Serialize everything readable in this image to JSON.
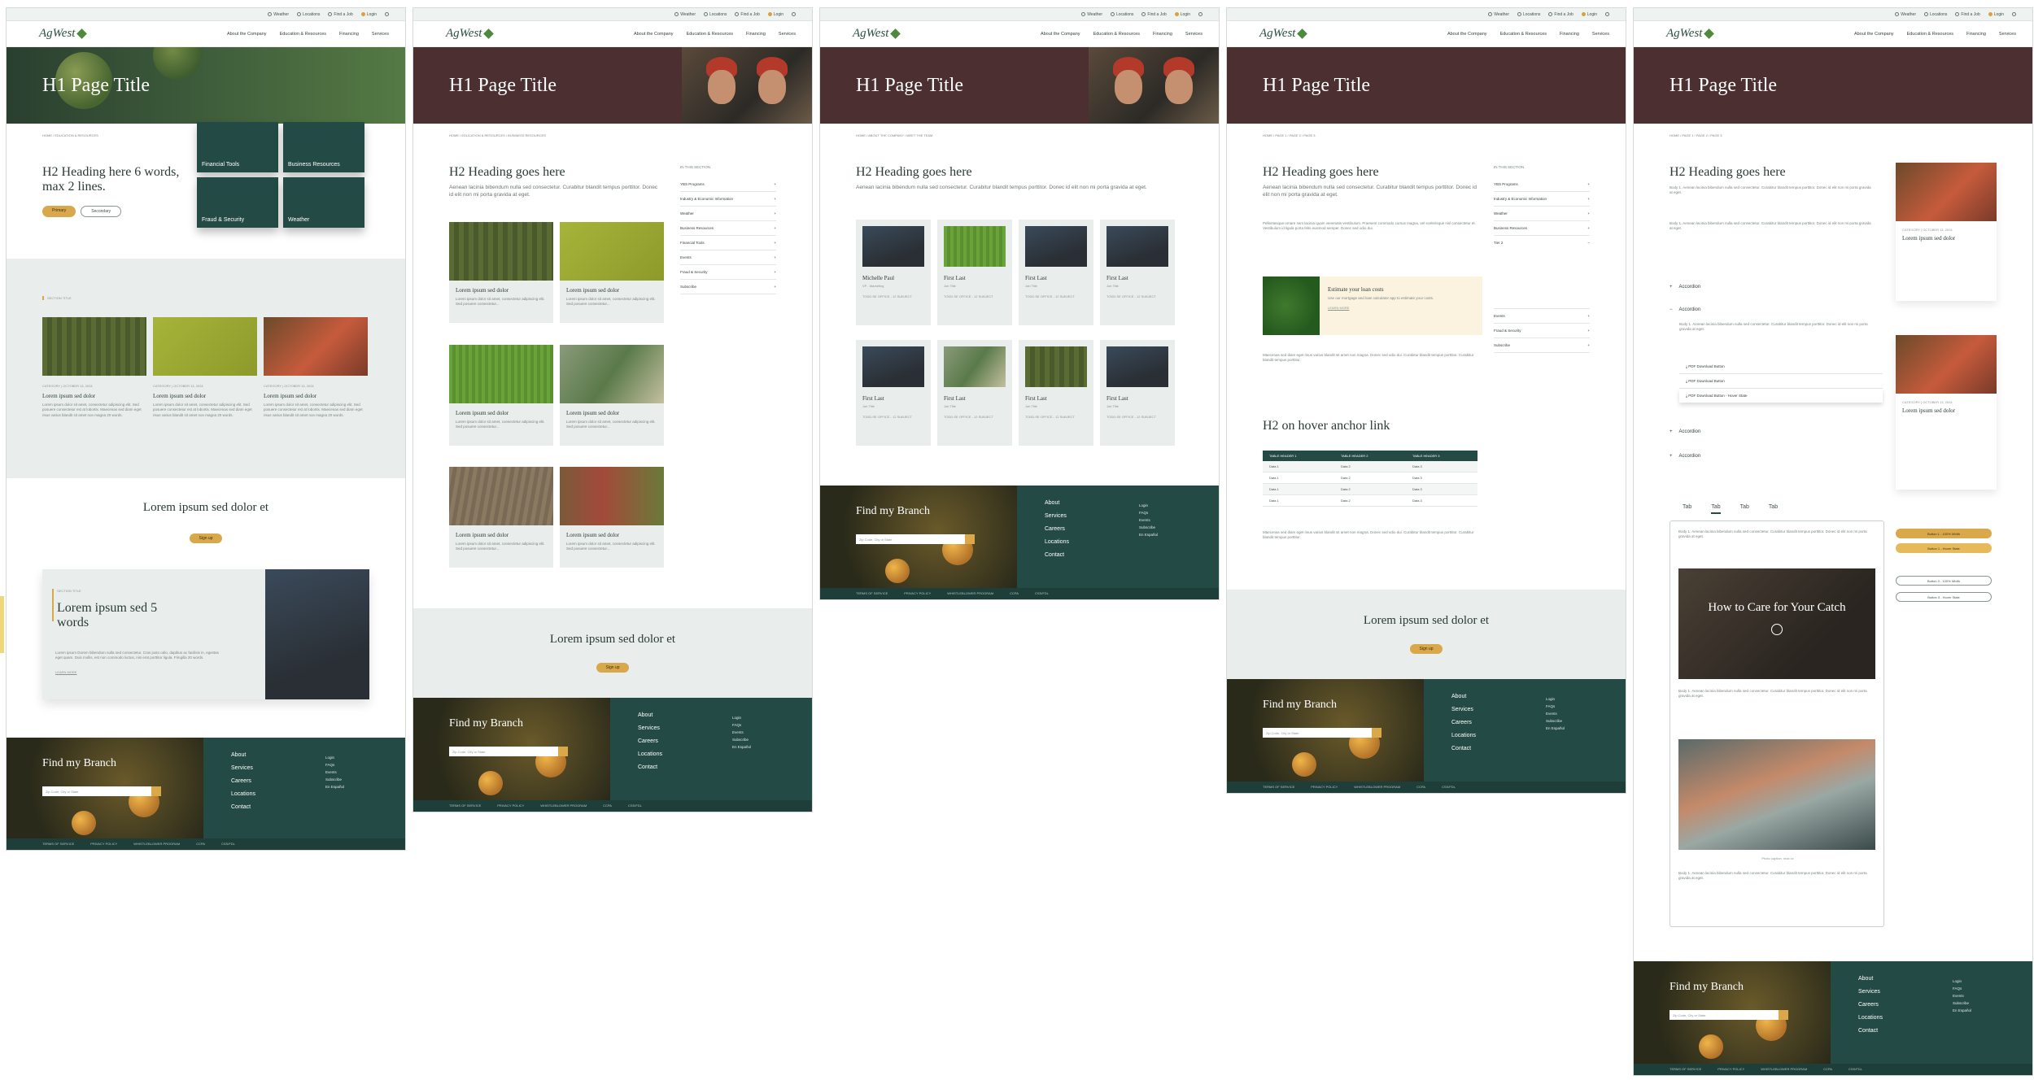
{
  "utility": {
    "weather": "Weather",
    "locations": "Locations",
    "find_job": "Find a Job",
    "login": "Login"
  },
  "nav": {
    "about": "About the Company",
    "education": "Education & Resources",
    "financing": "Financing",
    "services": "Services"
  },
  "logo": {
    "text": "AgWest"
  },
  "hero": {
    "title": "H1 Page Title"
  },
  "p1": {
    "breadcrumb": "HOME  /  EDUCATION & RESOURCES",
    "h2": "H2 Heading here 6 words, max 2 lines.",
    "primary": "Primary",
    "secondary": "Secondary",
    "tiles": [
      "Financial Tools",
      "Business Resources",
      "Fraud & Security",
      "Weather"
    ],
    "section_title": "SECTION TITLE",
    "cards": [
      {
        "meta": "CATEGORY  |  OCTOBER 13, 2024",
        "title": "Lorem ipsum sed dolor",
        "text": "Lorem ipsum dolor sit amet, consectetur adipiscing elit. Sed posuere consectetur est at lobortis. Maecenas sed diam eget risus varius blandit sit amet non magna 20 words."
      },
      {
        "meta": "CATEGORY  |  OCTOBER 13, 2024",
        "title": "Lorem ipsum sed dolor",
        "text": "Lorem ipsum dolor sit amet, consectetur adipiscing elit. Sed posuere consectetur est at lobortis. Maecenas sed diam eget risus varius blandit sit amet non magna 20 words."
      },
      {
        "meta": "CATEGORY  |  OCTOBER 13, 2024",
        "title": "Lorem ipsum sed dolor",
        "text": "Lorem ipsum dolor sit amet, consectetur adipiscing elit. Sed posuere consectetur est at lobortis. Maecenas sed diam eget risus varius blandit sit amet non magna 20 words."
      }
    ],
    "cta_title": "Lorem ipsum sed dolor et",
    "cta_btn": "Sign up",
    "feature_label": "SECTION TITLE",
    "feature_title": "Lorem ipsum sed 5 words",
    "feature_text": "Lorem ipsum Dorem bibendum nulla sed consectetur. Cras justo odio, dapibus ac facilisis in, egestas eget quam. Duis mollis, est non commodo luctus, nisi erat porttitor ligula. Fringilla 20 words.",
    "feature_link": "LEARN MORE"
  },
  "p2": {
    "breadcrumb": "HOME  /  EDUCATION & RESOURCES  /  BUSINESS RESOURCES",
    "h2": "H2 Heading goes here",
    "intro": "Aenean lacinia bibendum nulla sed consectetur. Curabitur blandit tempus porttitor. Donec id elit non mi porta gravida at eget.",
    "in_section": "IN THIS SECTION",
    "side": [
      "YBS Programs",
      "Industry & Economic Information",
      "Weather",
      "Business Resources",
      "Financial Tools",
      "Events",
      "Fraud & Security",
      "Subscribe"
    ],
    "card_title": "Lorem ipsum sed dolor",
    "card_text": "Lorem ipsum dolor sit amet, consectetur adipiscing elit. Sed posuere consectetur...",
    "cta_title": "Lorem ipsum sed dolor et",
    "cta_btn": "Sign up"
  },
  "p3": {
    "breadcrumb": "HOME  /  ABOUT THE COMPANY  /  MEET THE TEAM",
    "h2": "H2 Heading goes here",
    "intro": "Aenean lacinia bibendum nulla sed consectetur. Curabitur blandit tempus porttitor. Donec id elit non mi porta gravida at eget.",
    "people": [
      {
        "name": "Michelle Paul",
        "title": "VP - Marketing"
      },
      {
        "name": "First Last",
        "title": "Job Title"
      },
      {
        "name": "First Last",
        "title": "Job Title"
      },
      {
        "name": "First Last",
        "title": "Job Title"
      },
      {
        "name": "First Last",
        "title": "Job Title"
      },
      {
        "name": "First Last",
        "title": "Job Title"
      },
      {
        "name": "First Last",
        "title": "Job Title"
      },
      {
        "name": "First Last",
        "title": "Job Title"
      }
    ],
    "contact": "TODD.SE OFFICE - 12 SUBJECT"
  },
  "p4": {
    "breadcrumb": "HOME  /  PAGE 1  /  PAGE 2  /  PAGE 3",
    "h2": "H2 Heading goes here",
    "intro": "Aenean lacinia bibendum nulla sed consectetur. Curabitur blandit tempus porttitor. Donec id elit non mi porta gravida at eget.",
    "body1": "Pellentesque ornare sem lacinia quam venenatis vestibulum. Praesent commodo cursus magna, vel scelerisque nisl consectetur et. Vestibulum id ligula porta felis euismod semper. Donec sed odio dui.",
    "estimate_title": "Estimate your loan costs",
    "estimate_text": "Use our mortgage and loan calculator app to estimate your costs.",
    "estimate_link": "LEARN MORE",
    "body2": "Maecenas sed diam eget risus varius blandit sit amet non magna. Donec sed odio dui. Curabitur blandit tempus porttitor. Curabitur blandit tempus porttitor.",
    "h2_anchor": "H2 on hover anchor link",
    "table_headers": [
      "TABLE HEADER 1",
      "TABLE HEADER 2",
      "TABLE HEADER 3"
    ],
    "table_rows": [
      [
        "Data 1",
        "Data 2",
        "Data 3"
      ],
      [
        "Data 1",
        "Data 2",
        "Data 3"
      ],
      [
        "Data 1",
        "Data 2",
        "Data 3"
      ],
      [
        "Data 1",
        "Data 2",
        "Data 3"
      ]
    ],
    "in_section": "IN THIS SECTION",
    "side": [
      "YBS Programs",
      "Industry & Economic Information",
      "Weather",
      "Business Resources",
      "Tier 2",
      "Events",
      "Fraud & Security",
      "Subscribe"
    ],
    "cta_title": "Lorem ipsum sed dolor et",
    "cta_btn": "Sign up"
  },
  "p5": {
    "breadcrumb": "HOME  /  PAGE 1  /  PAGE 2  /  PAGE 3",
    "h2": "H2 Heading goes here",
    "body1": "Body 1. Aenean lacinia bibendum nulla sed consectetur. Curabitur blandit tempus porttitor. Donec id elit non mi porta gravida at eget.",
    "accordions": [
      "Accordion",
      "Accordion",
      "Accordion",
      "Accordion"
    ],
    "downloads": [
      "PDF Download Button",
      "PDF Download Button",
      "PDF Download Button - Hover State"
    ],
    "tabs": [
      "Tab",
      "Tab",
      "Tab",
      "Tab"
    ],
    "video_title": "How to Care for Your Catch",
    "photo_caption": "Photo caption, max xx",
    "side_card_title": "Lorem ipsum sed dolor",
    "side_card_meta": "CATEGORY  |  OCTOBER 13, 2024",
    "buttons": [
      "Button 1 - 100% Width",
      "Button 1 - Hover State",
      "Button 3 - 100% Width",
      "Button 3 - Hover State"
    ]
  },
  "footer": {
    "title": "Find my Branch",
    "placeholder": "Zip Code, City or State",
    "links": [
      "About",
      "Services",
      "Careers",
      "Locations",
      "Contact"
    ],
    "links2": [
      "Login",
      "FAQs",
      "Events",
      "Subscribe",
      "En Español"
    ],
    "bottom": [
      "TERMS OF SERVICE",
      "PRIVACY POLICY",
      "WHISTLEBLOWER PROGRAM",
      "CCPA",
      "CSS/FDL"
    ]
  },
  "colors": {
    "primary": "#234a44",
    "accent": "#d9a84a",
    "maroon": "#4b2f31"
  }
}
